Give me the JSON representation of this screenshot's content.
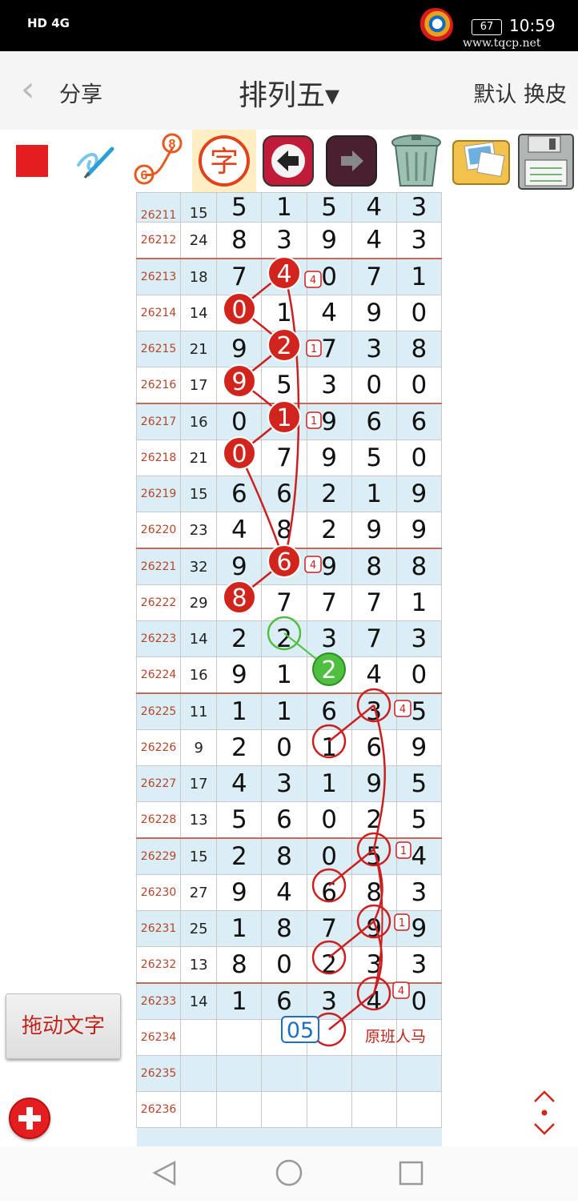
{
  "status_bar": {
    "network": "HD 4G",
    "battery": "67",
    "time": "10:59",
    "watermark": "www.tqcp.net"
  },
  "header": {
    "back_icon": "chevron-left-icon",
    "share": "分享",
    "title": "排列五▾",
    "right": "默认 换皮"
  },
  "toolbar": [
    {
      "name": "color-square-tool",
      "icon": "red-square-icon",
      "color": "#e41e1e"
    },
    {
      "name": "pen-tool",
      "icon": "pen-scribble-icon"
    },
    {
      "name": "connect-tool",
      "icon": "number-connect-icon",
      "from": "6",
      "to": "8"
    },
    {
      "name": "text-tool",
      "icon": "character-icon",
      "label": "字"
    },
    {
      "name": "undo-tool",
      "icon": "arrow-left-icon"
    },
    {
      "name": "redo-tool",
      "icon": "arrow-right-icon"
    },
    {
      "name": "delete-tool",
      "icon": "trash-can-icon"
    },
    {
      "name": "gallery-tool",
      "icon": "photo-album-icon"
    },
    {
      "name": "save-tool",
      "icon": "floppy-disk-icon"
    }
  ],
  "rows": [
    {
      "issue": "26211",
      "sum": "15",
      "nums": [
        "5",
        "1",
        "5",
        "4",
        "3"
      ]
    },
    {
      "issue": "26212",
      "sum": "24",
      "nums": [
        "8",
        "3",
        "9",
        "4",
        "3"
      ]
    },
    {
      "issue": "26213",
      "sum": "18",
      "nums": [
        "7",
        "4",
        "0",
        "7",
        "1"
      ]
    },
    {
      "issue": "26214",
      "sum": "14",
      "nums": [
        "0",
        "1",
        "4",
        "9",
        "0"
      ]
    },
    {
      "issue": "26215",
      "sum": "21",
      "nums": [
        "9",
        "2",
        "7",
        "3",
        "8"
      ]
    },
    {
      "issue": "26216",
      "sum": "17",
      "nums": [
        "9",
        "5",
        "3",
        "0",
        "0"
      ]
    },
    {
      "issue": "26217",
      "sum": "16",
      "nums": [
        "0",
        "1",
        "9",
        "6",
        "6"
      ]
    },
    {
      "issue": "26218",
      "sum": "21",
      "nums": [
        "0",
        "7",
        "9",
        "5",
        "0"
      ]
    },
    {
      "issue": "26219",
      "sum": "15",
      "nums": [
        "6",
        "6",
        "2",
        "1",
        "9"
      ]
    },
    {
      "issue": "26220",
      "sum": "23",
      "nums": [
        "4",
        "8",
        "2",
        "9",
        "9"
      ]
    },
    {
      "issue": "26221",
      "sum": "32",
      "nums": [
        "9",
        "6",
        "9",
        "8",
        "8"
      ]
    },
    {
      "issue": "26222",
      "sum": "29",
      "nums": [
        "8",
        "7",
        "7",
        "7",
        "1"
      ]
    },
    {
      "issue": "26223",
      "sum": "14",
      "nums": [
        "2",
        "2",
        "3",
        "7",
        "3"
      ]
    },
    {
      "issue": "26224",
      "sum": "16",
      "nums": [
        "9",
        "1",
        "2",
        "4",
        "0"
      ]
    },
    {
      "issue": "26225",
      "sum": "11",
      "nums": [
        "1",
        "1",
        "6",
        "3",
        "5"
      ]
    },
    {
      "issue": "26226",
      "sum": "9",
      "nums": [
        "2",
        "0",
        "1",
        "6",
        "9"
      ]
    },
    {
      "issue": "26227",
      "sum": "17",
      "nums": [
        "4",
        "3",
        "1",
        "9",
        "5"
      ]
    },
    {
      "issue": "26228",
      "sum": "13",
      "nums": [
        "5",
        "6",
        "0",
        "2",
        "5"
      ]
    },
    {
      "issue": "26229",
      "sum": "15",
      "nums": [
        "2",
        "8",
        "0",
        "5",
        "4"
      ]
    },
    {
      "issue": "26230",
      "sum": "27",
      "nums": [
        "9",
        "4",
        "6",
        "8",
        "3"
      ]
    },
    {
      "issue": "26231",
      "sum": "25",
      "nums": [
        "1",
        "8",
        "7",
        "9",
        "9"
      ]
    },
    {
      "issue": "26232",
      "sum": "13",
      "nums": [
        "8",
        "0",
        "2",
        "3",
        "3"
      ]
    },
    {
      "issue": "26233",
      "sum": "14",
      "nums": [
        "1",
        "6",
        "3",
        "4",
        "0"
      ]
    },
    {
      "issue": "26234",
      "sum": "",
      "nums": [
        "",
        "",
        "",
        "",
        ""
      ]
    },
    {
      "issue": "26235",
      "sum": "",
      "nums": [
        "",
        "",
        "",
        "",
        ""
      ]
    },
    {
      "issue": "26236",
      "sum": "",
      "nums": [
        "",
        "",
        "",
        "",
        ""
      ]
    }
  ],
  "prediction_box": "05",
  "note_text": "原班人马",
  "small_tags": [
    "4",
    "1",
    "1",
    "4",
    "4",
    "1",
    "1",
    "4"
  ],
  "drag_text_button": "拖动文字",
  "add_icon": "plus-circle-icon",
  "scroll_icon": "vertical-scroll-arrows-icon",
  "nav": {
    "back": "triangle-back-icon",
    "home": "circle-home-icon",
    "recent": "square-recent-icon"
  },
  "colors": {
    "accent_red": "#d0241c",
    "green_mark": "#4fbf3f",
    "prediction_blue": "#1e6fc4",
    "alt_row": "#dbeef6"
  }
}
